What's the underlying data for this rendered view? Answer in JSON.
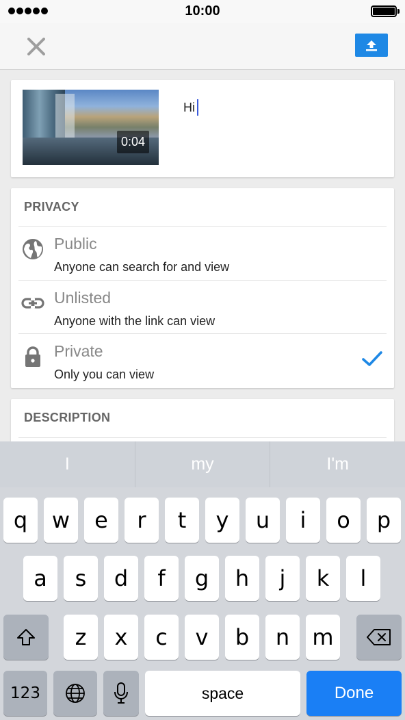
{
  "status_bar": {
    "time": "10:00"
  },
  "nav": {
    "close_icon": "close-icon",
    "upload_icon": "upload-icon",
    "accent": "#1e88e5"
  },
  "video": {
    "duration": "0:04",
    "title": "Hi"
  },
  "privacy": {
    "title": "PRIVACY",
    "options": [
      {
        "label": "Public",
        "description": "Anyone can search for and view",
        "icon": "globe-icon",
        "selected": false
      },
      {
        "label": "Unlisted",
        "description": "Anyone with the link can view",
        "icon": "link-icon",
        "selected": false
      },
      {
        "label": "Private",
        "description": "Only you can view",
        "icon": "lock-icon",
        "selected": true
      }
    ]
  },
  "description": {
    "title": "DESCRIPTION"
  },
  "keyboard": {
    "suggestions": [
      "I",
      "my",
      "I'm"
    ],
    "row1": [
      "q",
      "w",
      "e",
      "r",
      "t",
      "y",
      "u",
      "i",
      "o",
      "p"
    ],
    "row2": [
      "a",
      "s",
      "d",
      "f",
      "g",
      "h",
      "j",
      "k",
      "l"
    ],
    "row3": [
      "z",
      "x",
      "c",
      "v",
      "b",
      "n",
      "m"
    ],
    "numbers_label": "123",
    "space_label": "space",
    "done_label": "Done",
    "done_color": "#1a7ff5"
  }
}
